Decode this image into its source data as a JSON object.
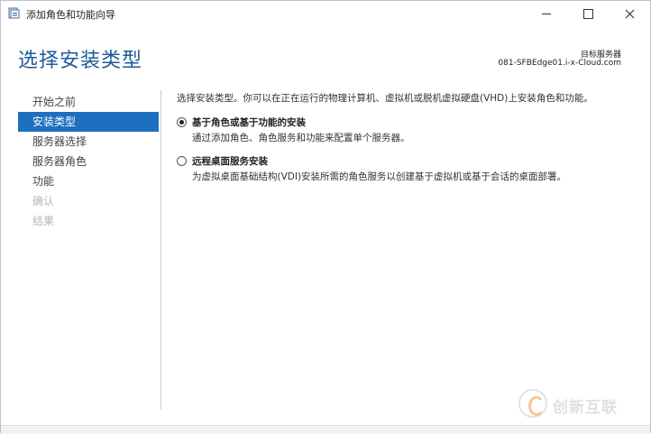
{
  "window": {
    "title": "添加角色和功能向导",
    "icon": "server-manager-icon"
  },
  "header": {
    "title": "选择安装类型",
    "target_label": "目标服务器",
    "target_server": "081-SFBEdge01.i-x-Cloud.com"
  },
  "sidebar": {
    "items": [
      {
        "label": "开始之前",
        "state": "normal"
      },
      {
        "label": "安装类型",
        "state": "active"
      },
      {
        "label": "服务器选择",
        "state": "normal"
      },
      {
        "label": "服务器角色",
        "state": "normal"
      },
      {
        "label": "功能",
        "state": "normal"
      },
      {
        "label": "确认",
        "state": "disabled"
      },
      {
        "label": "结果",
        "state": "disabled"
      }
    ]
  },
  "main": {
    "description": "选择安装类型。你可以在正在运行的物理计算机、虚拟机或脱机虚拟硬盘(VHD)上安装角色和功能。",
    "options": [
      {
        "title": "基于角色或基于功能的安装",
        "desc": "通过添加角色、角色服务和功能来配置单个服务器。",
        "checked": true
      },
      {
        "title": "远程桌面服务安装",
        "desc": "为虚拟桌面基础结构(VDI)安装所需的角色服务以创建基于虚拟机或基于会话的桌面部署。",
        "checked": false
      }
    ]
  },
  "watermark": {
    "text": "创新互联"
  },
  "colors": {
    "accent": "#1e6fbf",
    "title_blue": "#1e5a99"
  }
}
